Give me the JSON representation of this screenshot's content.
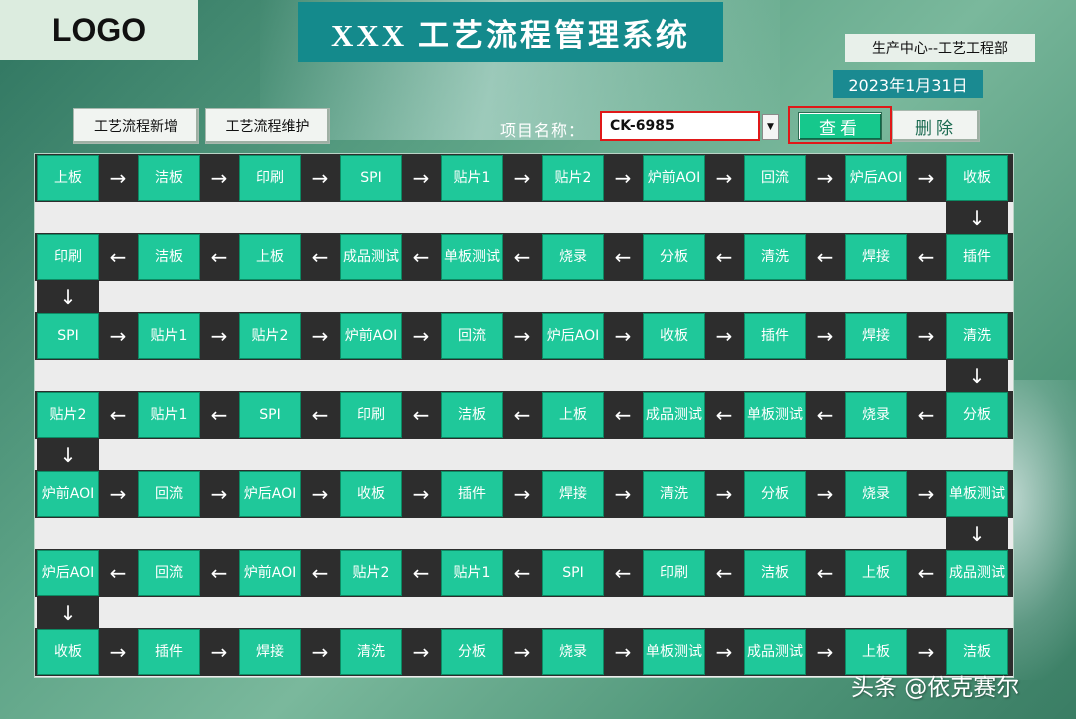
{
  "logo": "LOGO",
  "title": "XXX 工艺流程管理系统",
  "department": "生产中心--工艺工程部",
  "date": "2023年1月31日",
  "buttons": {
    "add": "工艺流程新增",
    "maintain": "工艺流程维护",
    "view": "查看",
    "delete": "删除"
  },
  "project": {
    "label": "项目名称：",
    "value": "CK-6985",
    "dropdown_icon": "caret-down-icon"
  },
  "arrows": {
    "right": "→",
    "left": "←",
    "down": "↓"
  },
  "flow": [
    {
      "dir": "right",
      "steps": [
        "上板",
        "洁板",
        "印刷",
        "SPI",
        "贴片1",
        "贴片2",
        "炉前AOI",
        "回流",
        "炉后AOI",
        "收板"
      ]
    },
    {
      "dir": "left",
      "steps": [
        "印刷",
        "洁板",
        "上板",
        "成品测试",
        "单板测试",
        "烧录",
        "分板",
        "清洗",
        "焊接",
        "插件"
      ]
    },
    {
      "dir": "right",
      "steps": [
        "SPI",
        "贴片1",
        "贴片2",
        "炉前AOI",
        "回流",
        "炉后AOI",
        "收板",
        "插件",
        "焊接",
        "清洗"
      ]
    },
    {
      "dir": "left",
      "steps": [
        "贴片2",
        "贴片1",
        "SPI",
        "印刷",
        "洁板",
        "上板",
        "成品测试",
        "单板测试",
        "烧录",
        "分板"
      ]
    },
    {
      "dir": "right",
      "steps": [
        "炉前AOI",
        "回流",
        "炉后AOI",
        "收板",
        "插件",
        "焊接",
        "清洗",
        "分板",
        "烧录",
        "单板测试"
      ]
    },
    {
      "dir": "left",
      "steps": [
        "炉后AOI",
        "回流",
        "炉前AOI",
        "贴片2",
        "贴片1",
        "SPI",
        "印刷",
        "洁板",
        "上板",
        "成品测试"
      ]
    },
    {
      "dir": "right",
      "steps": [
        "收板",
        "插件",
        "焊接",
        "清洗",
        "分板",
        "烧录",
        "单板测试",
        "成品测试",
        "上板",
        "洁板"
      ]
    }
  ],
  "watermark": "头条 @依克赛尔"
}
